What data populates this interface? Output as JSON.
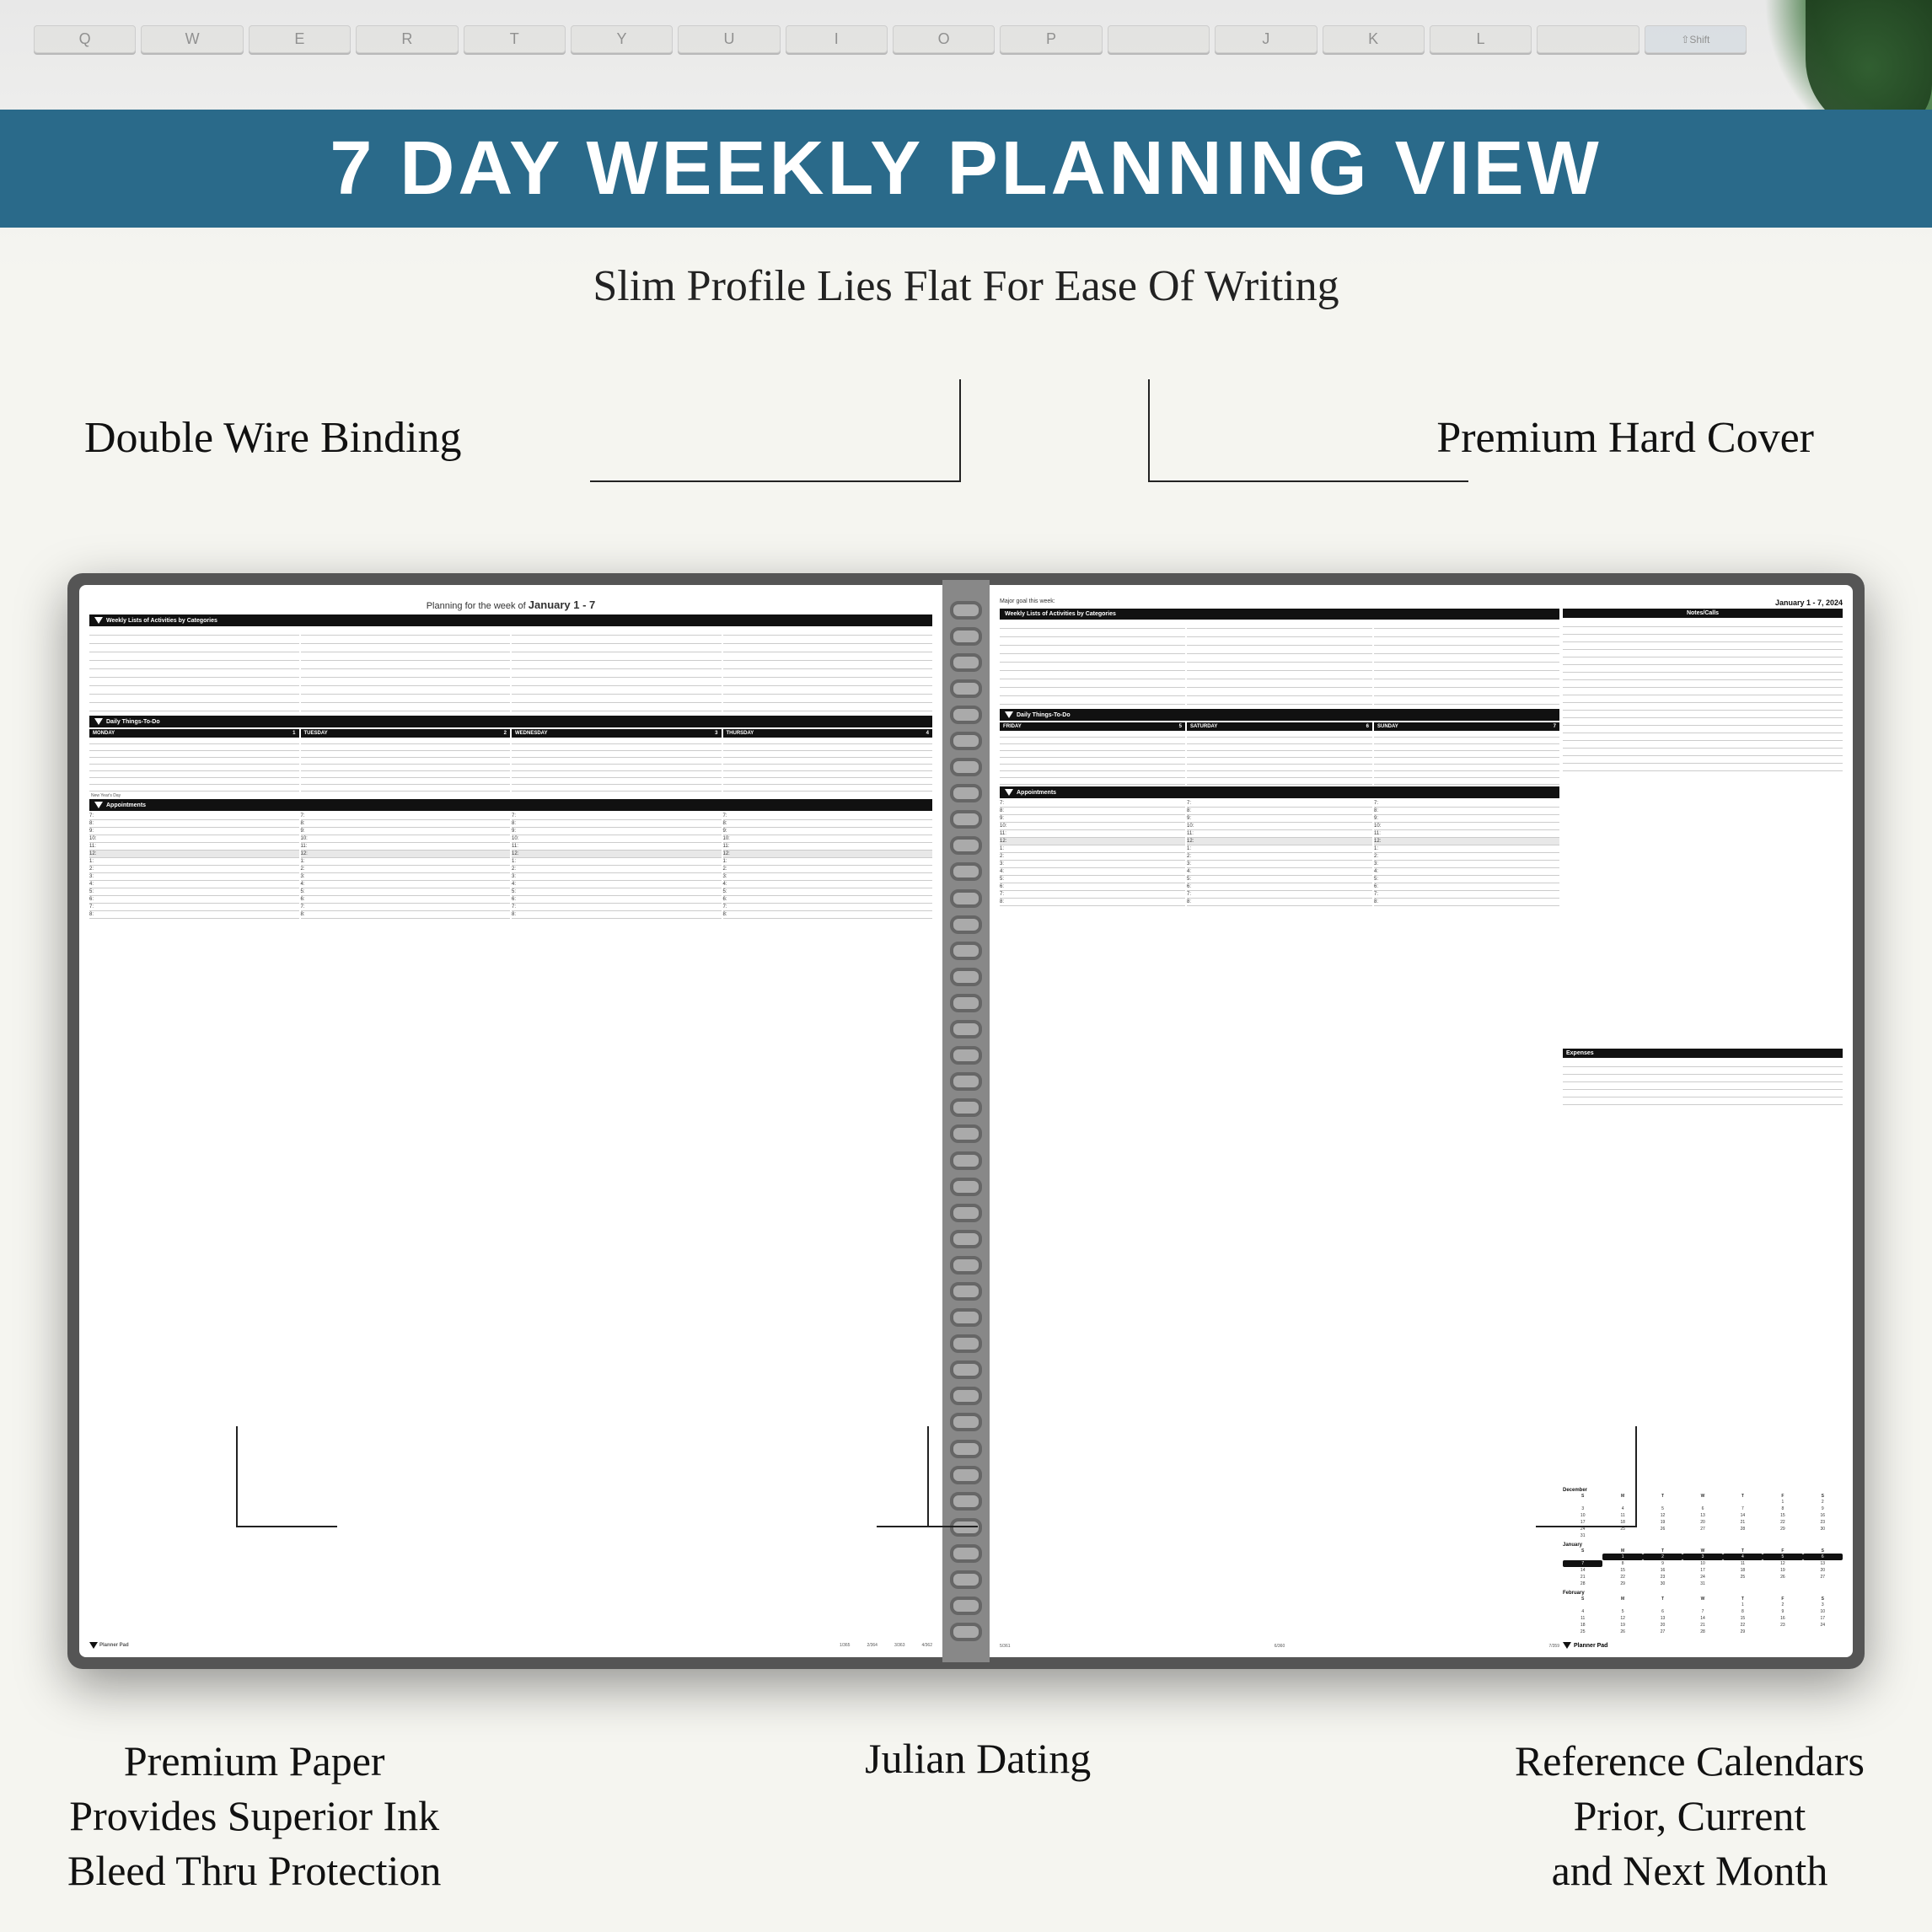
{
  "header": {
    "banner_bg": "#2a6a8a",
    "title": "7 DAY WEEKLY PLANNING VIEW",
    "subtitle": "Slim Profile Lies Flat For Ease Of Writing"
  },
  "labels": {
    "double_wire": "Double Wire Binding",
    "premium_cover": "Premium Hard Cover",
    "premium_paper": "Premium Paper\nProvides Superior Ink\nBleed Thru Protection",
    "julian_dating": "Julian Dating",
    "reference_calendars": "Reference Calendars\nPrior, Current\nand Next Month"
  },
  "left_page": {
    "planning_text": "Planning for the week of",
    "date_range": "January 1 - 7",
    "activities_label": "Weekly Lists of Activities by Categories",
    "daily_label": "Daily Things-To-Do",
    "days": [
      {
        "name": "MONDAY",
        "num": "1"
      },
      {
        "name": "TUESDAY",
        "num": "2"
      },
      {
        "name": "WEDNESDAY",
        "num": "3"
      },
      {
        "name": "THURSDAY",
        "num": "4"
      }
    ],
    "appointments_label": "Appointments",
    "holiday": "New Year's Day",
    "times": [
      "7:",
      "8:",
      "9:",
      "10:",
      "11:",
      "12:",
      "1:",
      "2:",
      "3:",
      "4:",
      "5:",
      "6:",
      "7:",
      "8:"
    ],
    "footer_nums": [
      "1/365",
      "2/364",
      "3/363",
      "4/362"
    ]
  },
  "right_page": {
    "goal_label": "Major goal this week:",
    "date_range": "January 1 - 7, 2024",
    "activities_label": "Weekly Lists of Activities by Categories",
    "notes_label": "Notes/Calls",
    "daily_label": "Daily Things-To-Do",
    "days": [
      {
        "name": "FRIDAY",
        "num": "5"
      },
      {
        "name": "SATURDAY",
        "num": "6"
      },
      {
        "name": "SUNDAY",
        "num": "7"
      }
    ],
    "appointments_label": "Appointments",
    "expenses_label": "Expenses",
    "times": [
      "7:",
      "8:",
      "9:",
      "10:",
      "11:",
      "12:",
      "1:",
      "2:",
      "3:",
      "4:",
      "5:",
      "6:",
      "7:",
      "8:"
    ],
    "footer_nums": [
      "5/361",
      "6/360",
      "7/359"
    ],
    "calendars": [
      {
        "month": "December",
        "headers": [
          "S",
          "M",
          "T",
          "W",
          "T",
          "F",
          "S"
        ],
        "rows": [
          [
            "",
            "",
            "",
            "",
            "",
            "1",
            "2"
          ],
          [
            "3",
            "4",
            "5",
            "6",
            "7",
            "8",
            "9"
          ],
          [
            "10",
            "11",
            "12",
            "13",
            "14",
            "15",
            "16"
          ],
          [
            "17",
            "18",
            "19",
            "20",
            "21",
            "22",
            "23"
          ],
          [
            "24",
            "25",
            "26",
            "27",
            "28",
            "29",
            "30"
          ],
          [
            "31",
            "",
            "",
            "",
            "",
            "",
            ""
          ]
        ]
      },
      {
        "month": "January",
        "headers": [
          "S",
          "M",
          "T",
          "W",
          "T",
          "F",
          "S"
        ],
        "rows": [
          [
            "",
            "1",
            "2",
            "3",
            "4",
            "5",
            "6"
          ],
          [
            "7",
            "8",
            "9",
            "10",
            "11",
            "12",
            "13"
          ],
          [
            "14",
            "15",
            "16",
            "17",
            "18",
            "19",
            "20"
          ],
          [
            "21",
            "22",
            "23",
            "24",
            "25",
            "26",
            "27"
          ],
          [
            "28",
            "29",
            "30",
            "31",
            "",
            "",
            ""
          ]
        ],
        "highlight": [
          "1",
          "2",
          "3",
          "4",
          "5",
          "6",
          "7"
        ]
      },
      {
        "month": "February",
        "headers": [
          "S",
          "M",
          "T",
          "W",
          "T",
          "F",
          "S"
        ],
        "rows": [
          [
            "",
            "",
            "",
            "",
            "1",
            "2",
            "3"
          ],
          [
            "4",
            "5",
            "6",
            "7",
            "8",
            "9",
            "10"
          ],
          [
            "11",
            "12",
            "13",
            "14",
            "15",
            "16",
            "17"
          ],
          [
            "18",
            "19",
            "20",
            "21",
            "22",
            "23",
            "24"
          ],
          [
            "25",
            "26",
            "27",
            "28",
            "29",
            "",
            ""
          ]
        ]
      }
    ],
    "planner_logo": "Planner Pad"
  }
}
